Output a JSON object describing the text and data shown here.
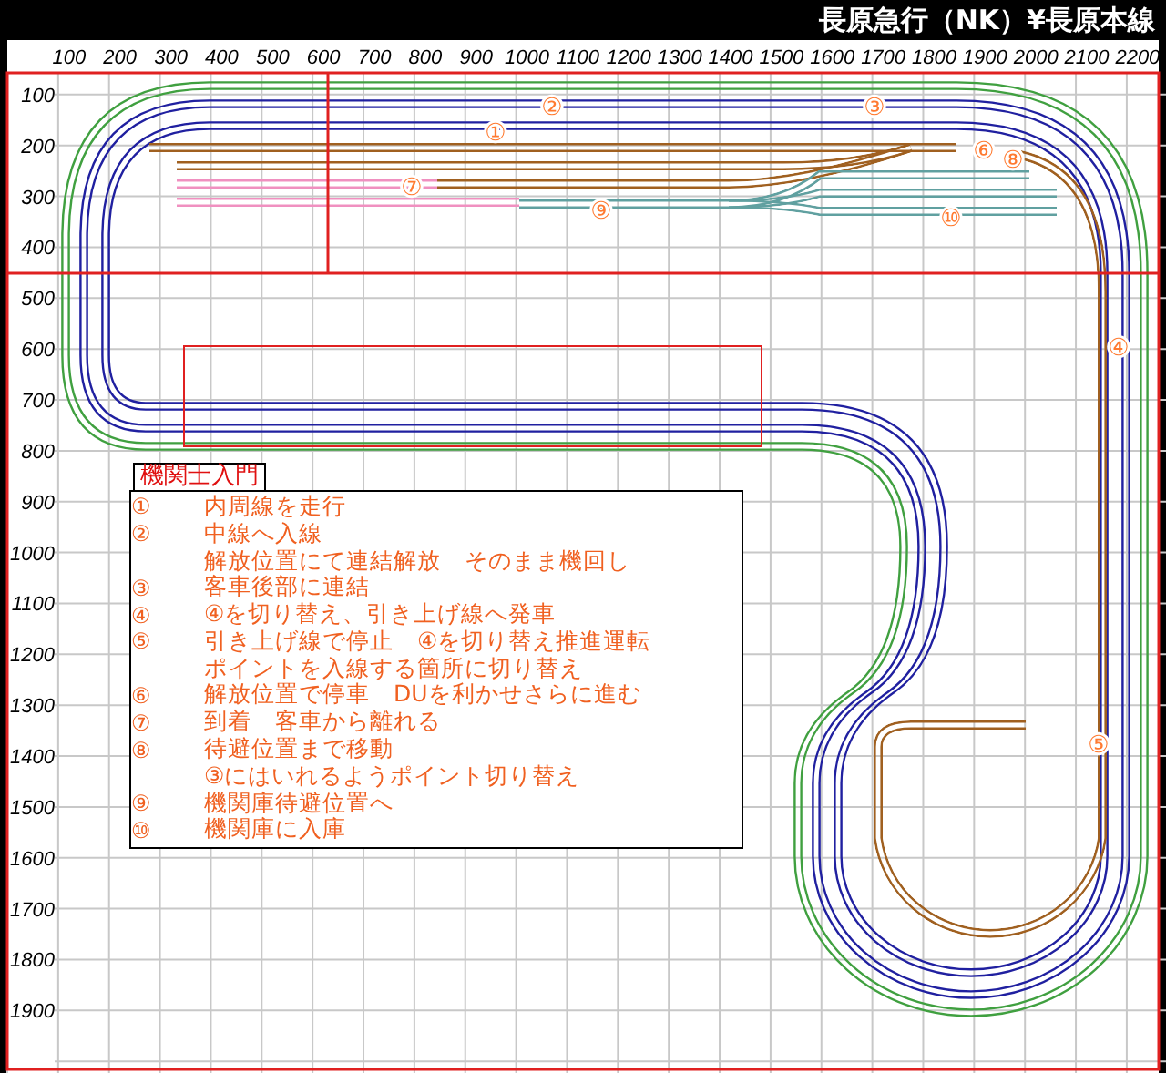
{
  "window": {
    "title": "長原急行（NK）¥長原本線"
  },
  "ruler": {
    "x_labels": [
      "100",
      "200",
      "300",
      "400",
      "500",
      "600",
      "700",
      "800",
      "900",
      "1000",
      "1100",
      "1200",
      "1300",
      "1400",
      "1500",
      "1600",
      "1700",
      "1800",
      "1900",
      "2000",
      "2100",
      "2200"
    ],
    "y_labels": [
      "100",
      "200",
      "300",
      "400",
      "500",
      "600",
      "700",
      "800",
      "900",
      "1000",
      "1100",
      "1200",
      "1300",
      "1400",
      "1500",
      "1600",
      "1700",
      "1800",
      "1900"
    ]
  },
  "track_labels": [
    "①",
    "②",
    "③",
    "④",
    "⑤",
    "⑥",
    "⑦",
    "⑧",
    "⑨",
    "⑩"
  ],
  "legend": {
    "title": "機関士入門",
    "lines": [
      {
        "mark": "①",
        "text": "内周線を走行"
      },
      {
        "mark": "②",
        "text": "中線へ入線"
      },
      {
        "text": "解放位置にて連結解放　そのまま機回し"
      },
      {
        "mark": "③",
        "text": "客車後部に連結"
      },
      {
        "mark": "④",
        "text": "④を切り替え、引き上げ線へ発車"
      },
      {
        "mark": "⑤",
        "text": "引き上げ線で停止　④を切り替え推進運転"
      },
      {
        "text": "ポイントを入線する箇所に切り替え"
      },
      {
        "mark": "⑥",
        "text": "解放位置で停車　DUを利かせさらに進む"
      },
      {
        "mark": "⑦",
        "text": "到着　客車から離れる"
      },
      {
        "mark": "⑧",
        "text": "待避位置まで移動"
      },
      {
        "text": "③にはいれるようポイント切り替え"
      },
      {
        "mark": "⑨",
        "text": "機関庫待避位置へ"
      },
      {
        "mark": "⑩",
        "text": "機関庫に入庫"
      }
    ]
  }
}
